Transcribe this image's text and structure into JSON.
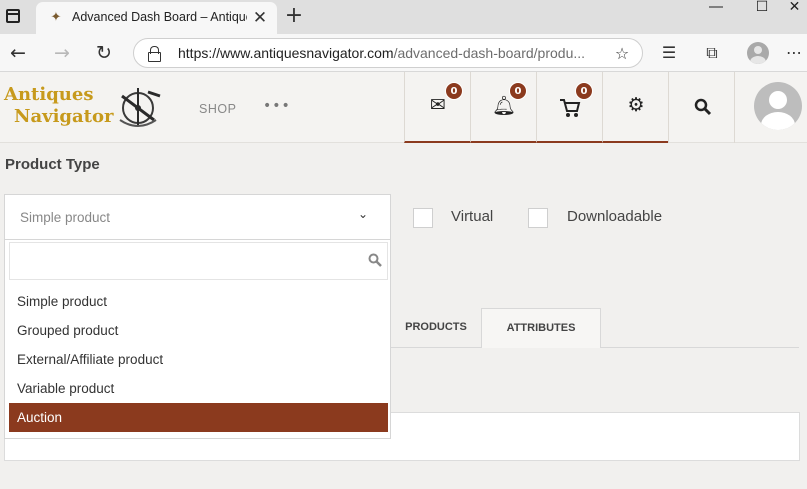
{
  "browser": {
    "tab_title": "Advanced Dash Board – Antique",
    "url_host": "https://www.antiquesnavigator.com",
    "url_path": "/advanced-dash-board/produ...",
    "icons": {
      "window": "window-menu-icon",
      "favicon": "site-favicon",
      "close_tab": "close-icon",
      "new_tab": "plus-icon",
      "minimize": "minimize-icon",
      "maximize": "maximize-icon",
      "close_window": "close-icon",
      "back": "back-arrow-icon",
      "forward": "forward-arrow-icon",
      "refresh": "refresh-icon",
      "lock": "lock-icon",
      "add_favorite": "star-plus-icon",
      "favorites": "favorites-icon",
      "collections": "collections-icon",
      "profile": "profile-avatar",
      "more": "more-icon"
    }
  },
  "site": {
    "logo_line1": "Antiques",
    "logo_line2": "Navigator",
    "nav_shop": "SHOP",
    "nav_more": "•••",
    "header_icons": [
      {
        "name": "mail-icon",
        "badge": "0"
      },
      {
        "name": "bell-icon",
        "badge": "0"
      },
      {
        "name": "cart-icon",
        "badge": "0"
      },
      {
        "name": "gear-icon"
      },
      {
        "name": "search-icon"
      }
    ],
    "accent_color": "#8b3a1e",
    "logo_color": "#c79a1c"
  },
  "form": {
    "product_type_label": "Product Type",
    "selected_value": "Simple product",
    "virtual_label": "Virtual",
    "downloadable_label": "Downloadable",
    "dropdown_options": [
      "Simple product",
      "Grouped product",
      "External/Affiliate product",
      "Variable product",
      "Auction"
    ],
    "highlighted_option": "Auction"
  },
  "product_tabs": [
    "PRODUCTS",
    "ATTRIBUTES"
  ]
}
